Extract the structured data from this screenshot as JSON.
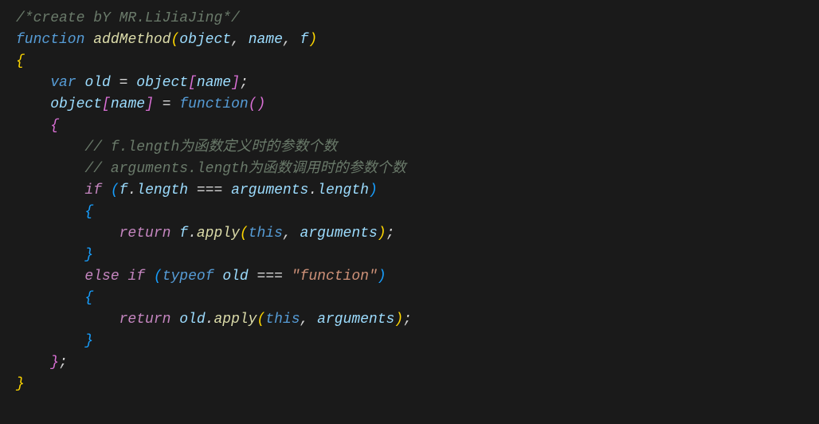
{
  "code": {
    "line1_comment": "/*create bY MR.LiJiaJing*/",
    "line2_function": "function",
    "line2_name": "addMethod",
    "line2_p1": "object",
    "line2_p2": "name",
    "line2_p3": "f",
    "line4_var": "var",
    "line4_old": "old",
    "line4_object": "object",
    "line4_name": "name",
    "line5_object": "object",
    "line5_name": "name",
    "line5_function": "function",
    "line7_comment": "// f.length为函数定义时的参数个数",
    "line8_comment": "// arguments.length为函数调用时的参数个数",
    "line9_if": "if",
    "line9_f": "f",
    "line9_length1": "length",
    "line9_arguments": "arguments",
    "line9_length2": "length",
    "line11_return": "return",
    "line11_f": "f",
    "line11_apply": "apply",
    "line11_this": "this",
    "line11_arguments": "arguments",
    "line13_else": "else",
    "line13_if": "if",
    "line13_typeof": "typeof",
    "line13_old": "old",
    "line13_string": "\"function\"",
    "line15_return": "return",
    "line15_old": "old",
    "line15_apply": "apply",
    "line15_this": "this",
    "line15_arguments": "arguments"
  }
}
